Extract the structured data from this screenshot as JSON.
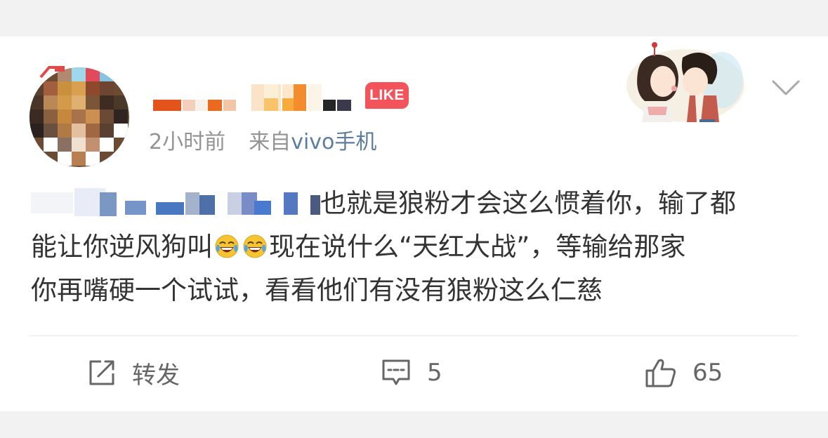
{
  "post": {
    "like_badge": "LIKE",
    "time": "2小时前",
    "source_prefix": "来自",
    "source_device": "vivo手机",
    "text": {
      "line1": "也就是狼粉才会这么惯着你，输了都",
      "line2_a": "能让你逆风狗叫",
      "line2_b": "现在说什么“天红大战”，等输给那家",
      "line3": "你再嘴硬一个试试，看看他们有没有狼粉这么仁慈"
    }
  },
  "icons": {
    "dropdown": "chevron-down-icon",
    "repost": "repost-icon",
    "comment": "comment-icon",
    "like": "thumbs-up-icon",
    "emoji": "laughing-crying-emoji"
  },
  "actions": {
    "repost_label": "转发",
    "comment_count": "5",
    "like_count": "65"
  },
  "colors": {
    "background": "#f2f2f2",
    "card": "#ffffff",
    "text": "#333333",
    "meta_gray": "#939393",
    "source_blue": "#5d7da0",
    "badge_red": "#f3545b",
    "action_gray": "#666666"
  }
}
